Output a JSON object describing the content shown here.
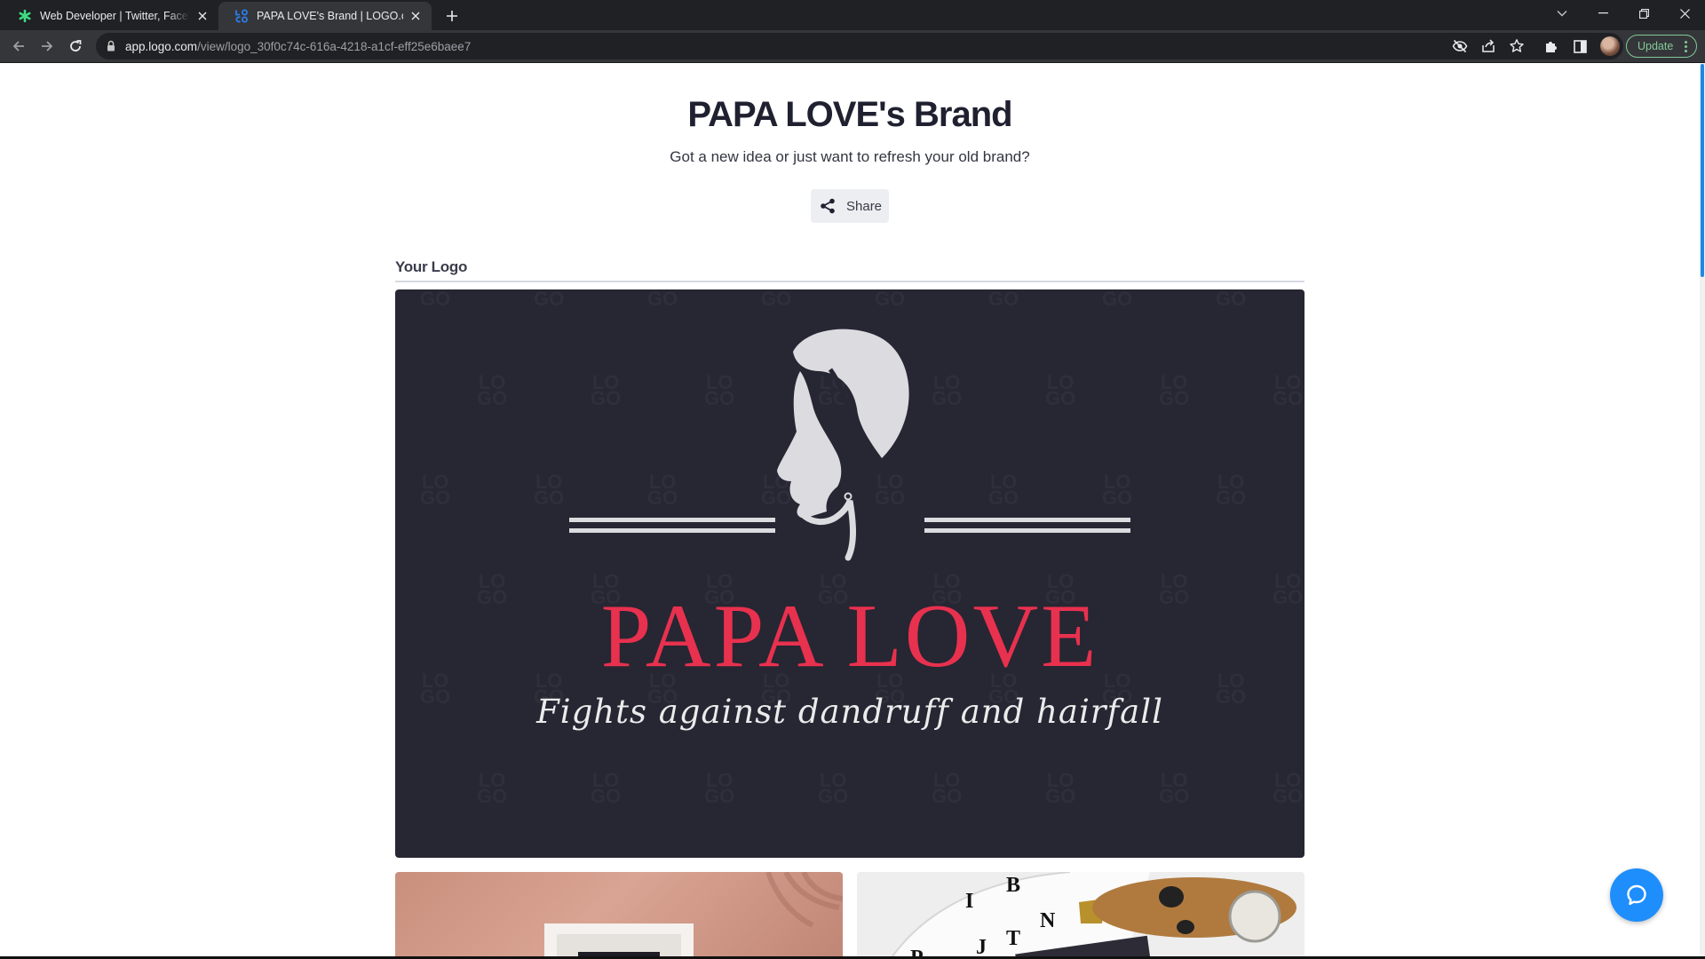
{
  "browser": {
    "tabs": [
      {
        "title": "Web Developer | Twitter, Facebook",
        "icon": "green-asterisk-icon",
        "active": false
      },
      {
        "title": "PAPA LOVE's Brand | LOGO.com",
        "icon": "logo-com-favicon",
        "active": true
      }
    ],
    "url_host": "app.logo.com",
    "url_path": "/view/logo_30f0c74c-616a-4218-a1cf-eff25e6baee7",
    "update_label": "Update",
    "colors": {
      "tabstrip": "#202124",
      "toolbar": "#35363a",
      "update": "#81c995"
    }
  },
  "page": {
    "title": "PAPA LOVE's Brand",
    "subtitle": "Got a new idea or just want to refresh your old brand?",
    "share_label": "Share",
    "section_title": "Your Logo"
  },
  "logo": {
    "name": "PAPA LOVE",
    "tagline": "Fights against dandruff and hairfall",
    "watermark": [
      "LO",
      "GO"
    ],
    "colors": {
      "background": "#272633",
      "name": "#e8314e",
      "tagline": "#ebebec",
      "icon": "#dcdbe0"
    }
  },
  "mockups": [
    {
      "name": "frame-mockup"
    },
    {
      "name": "stationery-mockup",
      "letters": [
        "I",
        "B",
        "N",
        "T",
        "J",
        "P"
      ]
    }
  ],
  "colors": {
    "accent": "#1e8efc",
    "title": "#1f2130"
  }
}
